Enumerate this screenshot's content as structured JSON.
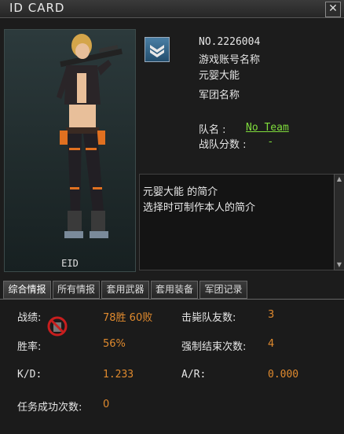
{
  "window": {
    "title": "ID CARD",
    "close_label": "✕"
  },
  "profile": {
    "portrait_caption": "EID",
    "number": "NO.2226004",
    "account_name_label": "游戏账号名称",
    "account_name": "元婴大能",
    "clan_name_label": "军团名称",
    "team_label": "队名 :",
    "team_name": "No Team",
    "team_score_label": "战队分数 :",
    "team_score": "-"
  },
  "intro": {
    "line1": "元婴大能  的简介",
    "line2": "选择时可制作本人的简介"
  },
  "tabs": [
    "综合情报",
    "所有情报",
    "套用武器",
    "套用装备",
    "军团记录"
  ],
  "stats": {
    "record_label": "战绩:",
    "record_value": "78胜 60败",
    "kills_label": "击毙队友数:",
    "kills_value": "3",
    "winrate_label": "胜率:",
    "winrate_value": "56%",
    "forced_end_label": "强制结束次数:",
    "forced_end_value": "4",
    "kd_label": "K/D:",
    "kd_value": "1.233",
    "ar_label": "A/R:",
    "ar_value": "0.000",
    "mission_label": "任务成功次数:",
    "mission_value": "0"
  },
  "colors": {
    "value": "#e08a2e",
    "link": "#7fdc3c",
    "background": "#1c1c1c"
  }
}
